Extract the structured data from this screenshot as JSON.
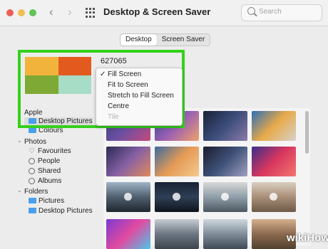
{
  "window": {
    "title": "Desktop & Screen Saver",
    "search_placeholder": "Search",
    "traffic_lights": [
      "#ec5f57",
      "#f3bd4f",
      "#5fc455"
    ]
  },
  "tabs": [
    {
      "label": "Desktop",
      "active": true
    },
    {
      "label": "Screen Saver",
      "active": false
    }
  ],
  "wallpaper": {
    "name": "627065",
    "preview_colors": [
      "#f2b33d",
      "#e35a1f",
      "#7ea934",
      "#a7dcc6"
    ]
  },
  "fit_menu": {
    "items": [
      {
        "label": "Fill Screen",
        "checked": true,
        "enabled": true
      },
      {
        "label": "Fit to Screen",
        "checked": false,
        "enabled": true
      },
      {
        "label": "Stretch to Fill Screen",
        "checked": false,
        "enabled": true
      },
      {
        "label": "Centre",
        "checked": false,
        "enabled": true
      },
      {
        "label": "Tile",
        "checked": false,
        "enabled": false
      }
    ]
  },
  "sidebar": {
    "apple": {
      "label": "Apple",
      "items": [
        "Desktop Pictures",
        "Colours"
      ]
    },
    "photos": {
      "label": "Photos",
      "items": [
        "Favourites",
        "People",
        "Shared",
        "Albums"
      ]
    },
    "folders": {
      "label": "Folders",
      "items": [
        "Pictures",
        "Desktop Pictures"
      ]
    }
  },
  "highlight_color": "#34d11c",
  "watermark": "wikiHow"
}
